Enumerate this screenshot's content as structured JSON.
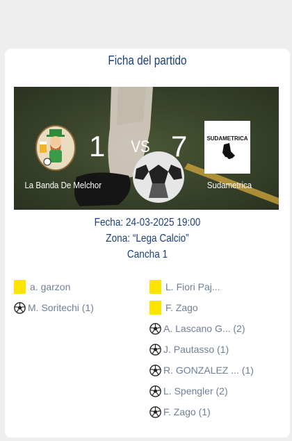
{
  "card": {
    "title": "Ficha del partido"
  },
  "match": {
    "home_team": "La Banda De Melchor",
    "away_team": "Sudametrica",
    "home_score": "1",
    "away_score": "7",
    "vs": "VS",
    "away_logo_text": "SUDAMETRICA",
    "date": "Fecha: 24-03-2025 19:00",
    "zone": "Zona: “Lega Calcio”",
    "court": "Cancha 1"
  },
  "events": {
    "home": [
      {
        "type": "yellow-card",
        "text": "a. garzon"
      },
      {
        "type": "goal",
        "text": "M. Soritechi (1)"
      }
    ],
    "away": [
      {
        "type": "yellow-card",
        "text": "L. Fiori Paj..."
      },
      {
        "type": "yellow-card",
        "text": "F. Zago"
      },
      {
        "type": "goal",
        "text": "A. Lascano G... (2)"
      },
      {
        "type": "goal",
        "text": "J. Pautasso (1)"
      },
      {
        "type": "goal",
        "text": "R. GONZALEZ ... (1)"
      },
      {
        "type": "goal",
        "text": "L. Spengler (2)"
      },
      {
        "type": "goal",
        "text": "F. Zago (1)"
      }
    ]
  },
  "colors": {
    "title": "#1c3f7c",
    "event_text": "#6f7f98",
    "yellow_card": "#ffe400"
  }
}
